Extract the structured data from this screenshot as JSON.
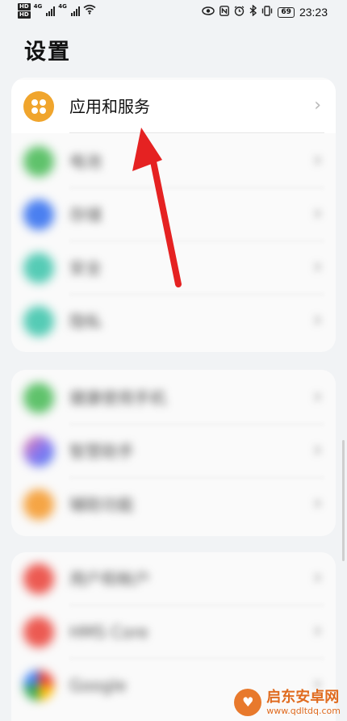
{
  "status_bar": {
    "sim1_badge": "HD",
    "sim2_badge": "HD",
    "network1": "4G",
    "network2": "4G",
    "battery": "69",
    "time": "23:23",
    "icons": [
      "eye-icon",
      "nfc-icon",
      "alarm-icon",
      "bluetooth-icon",
      "vibrate-icon",
      "wifi-icon"
    ]
  },
  "title": "设置",
  "groups": [
    {
      "items": [
        {
          "label": "应用和服务",
          "icon": "apps-icon",
          "color": "#f0a52d",
          "focused": true
        },
        {
          "label": "电池",
          "icon": "battery-icon",
          "color": "#5fc26b"
        },
        {
          "label": "存储",
          "icon": "storage-icon",
          "color": "#4a7ff0"
        },
        {
          "label": "安全",
          "icon": "security-icon",
          "color": "#55cbb5"
        },
        {
          "label": "隐私",
          "icon": "privacy-icon",
          "color": "#55cbb5"
        }
      ]
    },
    {
      "items": [
        {
          "label": "健康使用手机",
          "icon": "health-icon",
          "color": "#5fc26b"
        },
        {
          "label": "智慧助手",
          "icon": "assistant-icon",
          "color": "#8a78f0"
        },
        {
          "label": "辅助功能",
          "icon": "accessibility-icon",
          "color": "#f5a545"
        }
      ]
    },
    {
      "items": [
        {
          "label": "用户和帐户",
          "icon": "user-icon",
          "color": "#ec5a52"
        },
        {
          "label": "HMS Core",
          "icon": "hms-icon",
          "color": "#ec5a52"
        },
        {
          "label": "Google",
          "icon": "google-icon",
          "color": "#3a86f0"
        }
      ]
    }
  ],
  "chevron": "›",
  "accent_colors": {
    "arrow": "#e52222",
    "background": "#f1f3f5"
  },
  "watermark": {
    "name": "启东安卓网",
    "url": "www.qdltdq.com"
  }
}
